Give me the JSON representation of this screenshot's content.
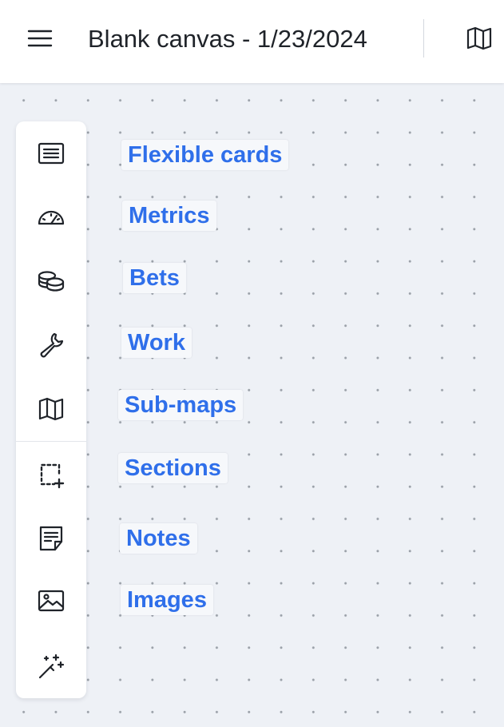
{
  "header": {
    "title": "Blank canvas - 1/23/2024",
    "menu_icon": "hamburger-menu-icon",
    "map_icon": "map-icon"
  },
  "toolbar": {
    "tools": [
      {
        "icon": "card-list-icon",
        "label": "Flexible cards"
      },
      {
        "icon": "gauge-icon",
        "label": "Metrics"
      },
      {
        "icon": "coins-icon",
        "label": "Bets"
      },
      {
        "icon": "wrench-icon",
        "label": "Work"
      },
      {
        "icon": "map-icon",
        "label": "Sub-maps"
      },
      {
        "icon": "section-add-icon",
        "label": "Sections"
      },
      {
        "icon": "note-icon",
        "label": "Notes"
      },
      {
        "icon": "image-icon",
        "label": "Images"
      },
      {
        "icon": "magic-wand-icon",
        "label": ""
      }
    ]
  },
  "labels": [
    "Flexible cards",
    "Metrics",
    "Bets",
    "Work",
    "Sub-maps",
    "Sections",
    "Notes",
    "Images"
  ],
  "colors": {
    "accent": "#2f6fea",
    "canvas": "#eef1f6",
    "icon": "#1f2329"
  }
}
